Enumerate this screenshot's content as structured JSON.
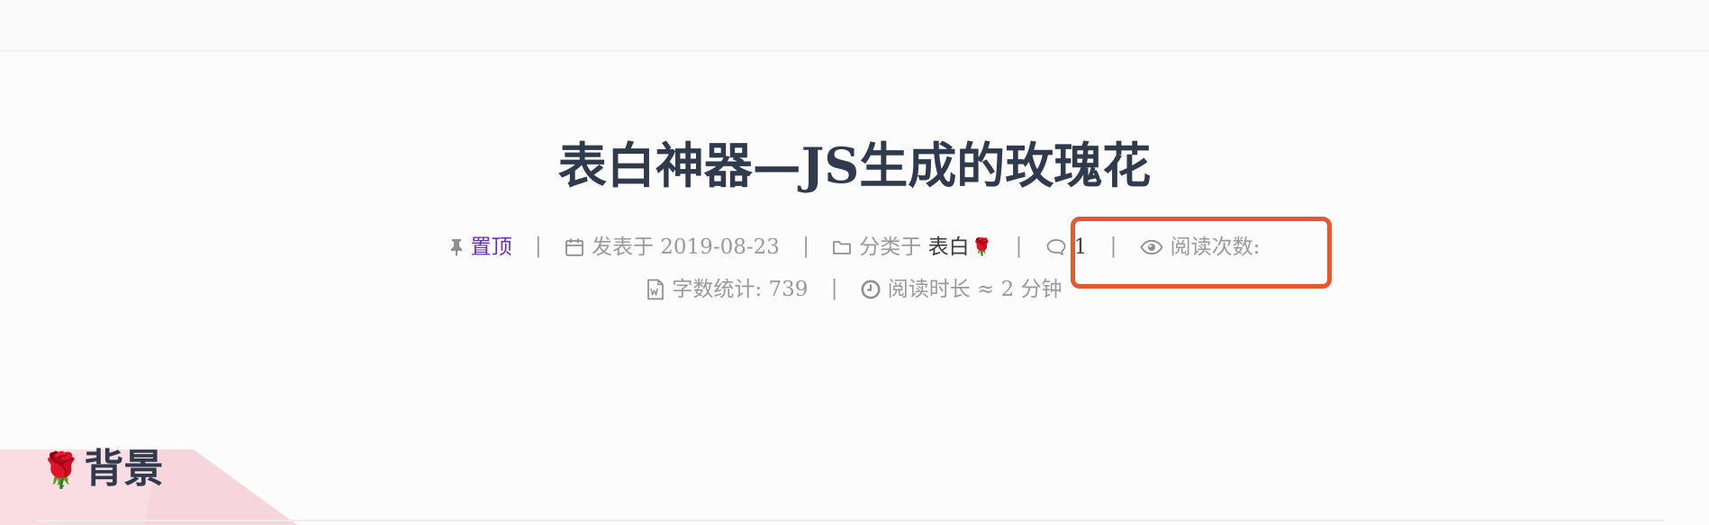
{
  "post": {
    "title": "表白神器—JS生成的玫瑰花",
    "pinned_label": "置顶",
    "published_label": "发表于",
    "published_date": "2019-08-23",
    "category_label": "分类于",
    "category_name": "表白",
    "category_emoji": "🌹",
    "comment_count": "1",
    "views_label": "阅读次数:",
    "word_count_label": "字数统计:",
    "word_count": "739",
    "read_time_label": "阅读时长 ≈ 2 分钟",
    "separator": "|"
  },
  "section": {
    "emoji": "🌹",
    "heading": "背景"
  },
  "colors": {
    "title": "#2f3b4c",
    "meta": "#9a9a9a",
    "pinned_link": "#6a2fb0",
    "highlight": "#e8582f",
    "banner": "#f9dde3"
  },
  "icons": [
    "thumbtack-icon",
    "calendar-icon",
    "folder-icon",
    "comment-icon",
    "eye-icon",
    "word-doc-icon",
    "clock-icon"
  ]
}
